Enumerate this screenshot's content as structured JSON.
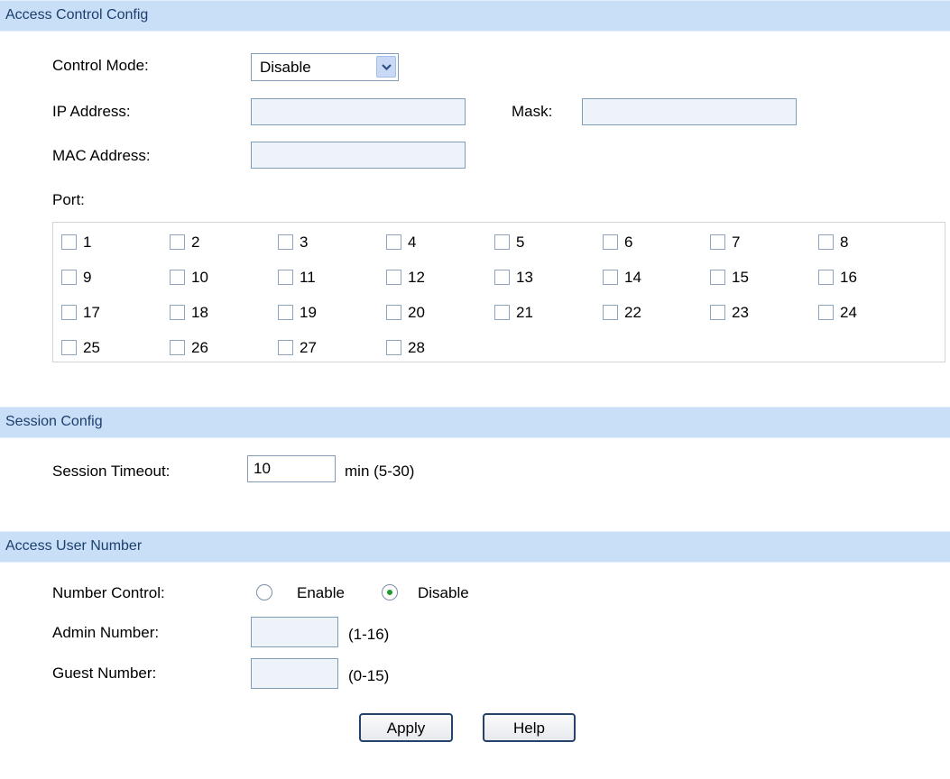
{
  "sections": {
    "access_control": "Access Control Config",
    "session": "Session Config",
    "user_number": "Access User Number"
  },
  "access_control": {
    "control_mode_label": "Control Mode:",
    "control_mode_value": "Disable",
    "ip_label": "IP Address:",
    "ip_value": "",
    "mask_label": "Mask:",
    "mask_value": "",
    "mac_label": "MAC Address:",
    "mac_value": "",
    "port_label": "Port:",
    "ports": [
      "1",
      "2",
      "3",
      "4",
      "5",
      "6",
      "7",
      "8",
      "9",
      "10",
      "11",
      "12",
      "13",
      "14",
      "15",
      "16",
      "17",
      "18",
      "19",
      "20",
      "21",
      "22",
      "23",
      "24",
      "25",
      "26",
      "27",
      "28"
    ],
    "ports_checked": []
  },
  "session": {
    "timeout_label": "Session Timeout:",
    "timeout_value": "10",
    "timeout_unit": "min (5-30)"
  },
  "user_number": {
    "control_label": "Number Control:",
    "enable_label": "Enable",
    "disable_label": "Disable",
    "selected": "Disable",
    "admin_label": "Admin Number:",
    "admin_value": "",
    "admin_range": "(1-16)",
    "guest_label": "Guest Number:",
    "guest_value": "",
    "guest_range": "(0-15)"
  },
  "buttons": {
    "apply": "Apply",
    "help": "Help"
  },
  "colors": {
    "header_bg": "#c9def7",
    "header_text": "#1c3f6e",
    "radio_selected": "#1f9a2f"
  }
}
